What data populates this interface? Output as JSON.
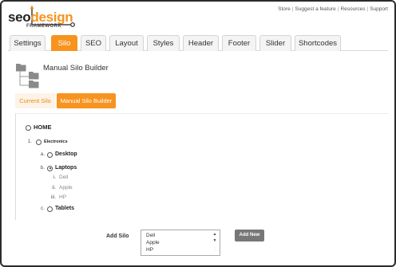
{
  "logo": {
    "seo": "seo",
    "design": "design",
    "sub": "FRAMEWORK"
  },
  "top_links": [
    "Store",
    "Suggest a feature",
    "Resources",
    "Support"
  ],
  "tabs": [
    "Settings",
    "Silo",
    "SEO",
    "Layout",
    "Styles",
    "Header",
    "Footer",
    "Slider",
    "Shortcodes"
  ],
  "active_tab": "Silo",
  "page_title": "Manual Silo Builder",
  "subtabs": {
    "current": "Current Silo",
    "manual": "Manual Silo Builder"
  },
  "tree": {
    "home": "HOME",
    "electronics_marker": "1.",
    "electronics": "Electronics",
    "desktop_marker": "a.",
    "desktop": "Desktop",
    "laptops_marker": "b.",
    "laptops": "Laptops",
    "leaves": [
      {
        "marker": "i.",
        "label": "Dell"
      },
      {
        "marker": "ii.",
        "label": "Apple"
      },
      {
        "marker": "iii.",
        "label": "HP"
      }
    ],
    "tablets_marker": "c.",
    "tablets": "Tablets",
    "selected": "Laptops"
  },
  "add_silo": {
    "label": "Add Silo",
    "options": [
      "Dell",
      "Apple",
      "HP"
    ],
    "button": "Add New"
  },
  "colors": {
    "accent": "#f7931e",
    "button_gray": "#777777"
  },
  "icons": {
    "folders": "folder-tree-icon",
    "scroll_up": "chevron-up-icon",
    "scroll_down": "chevron-down-icon"
  }
}
